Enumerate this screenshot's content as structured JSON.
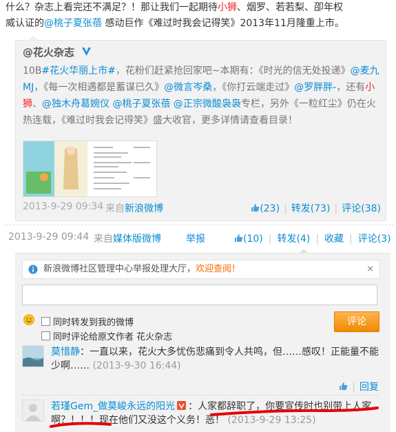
{
  "top_text": {
    "line1_a": "什么？杂志上看完还不满足？！那让我们一起期待",
    "line1_red": "小狮",
    "line1_b": "、烟罗、若若梨、卲年权",
    "line2_a": "威认证的",
    "line2_link": "@桃子夏张蓓",
    "line2_b": " 感动巨作《难过时我会记得笑》2013年11月隆重上市。"
  },
  "quoted": {
    "author": "@花火杂志",
    "body": {
      "p1": "10B",
      "p1_tag": "#花火华丽上市#",
      "p2": "，花粉们赶紧抢回家吧~本期有：《时光的信无处投递》",
      "m1": "@麦九MJ",
      "p3": "，《每一次相遇都是蓄谋已久》",
      "m2": "@微言岑桑",
      "p4": "，《你打云端走过》",
      "m3": "@罗胖胖-",
      "p5": "，还有",
      "red": "小狮",
      "p6": "、",
      "m4": "@独木舟葛婉仪",
      "m5": "@桃子夏张蓓",
      "m6": "@正宗微酸袅袅",
      "p7": "专栏，另外《一粒红尘》仍在火热连载，《难过时我会记得笑》盛大收官，更多详情请查看目录！"
    },
    "time": "2013-9-29 09:34",
    "source_prefix": "来自",
    "source": "新浪微博",
    "likes": "(23)",
    "repost": "转发(73)",
    "comment": "评论(38)"
  },
  "main": {
    "time": "2013-9-29 09:44",
    "source_prefix": "来自",
    "source": "媒体版微博",
    "report": "举报",
    "likes": "(10)",
    "repost": "转发(4)",
    "favorite": "收藏",
    "comment": "评论(3)"
  },
  "comment_panel": {
    "notice_text": "新浪微博社区管理中心举报处理大厅，",
    "notice_link": "欢迎查阅！",
    "notice_close": "×",
    "cb1": "同时转发到我的微博",
    "cb2": "同时评论给原文作者 花火杂志",
    "submit": "评论",
    "comments": [
      {
        "name": "莫惜静",
        "text": "：一直以来，花火大多忧伤悲痛到令人共鸣，但……感叹！正能量不能少啊……",
        "time": "(2013-9-30 16:44)",
        "reply": "回复"
      },
      {
        "name": "若瑾Gem_做莫峻永远的阳光",
        "text": "：人家都辞职了，你要宣传时也别带上人家啊？！！！现在他们又没这个义务！恶！",
        "time": "(2013-9-29 13:25)"
      }
    ]
  },
  "colors": {
    "link": "#0a8cd2",
    "red": "#e22",
    "accent": "#f08a00",
    "annotation": "#e60000"
  },
  "icons": [
    "verified-v-icon",
    "like-thumb-icon",
    "info-icon",
    "close-icon",
    "emoji-icon",
    "vip-badge-icon"
  ]
}
